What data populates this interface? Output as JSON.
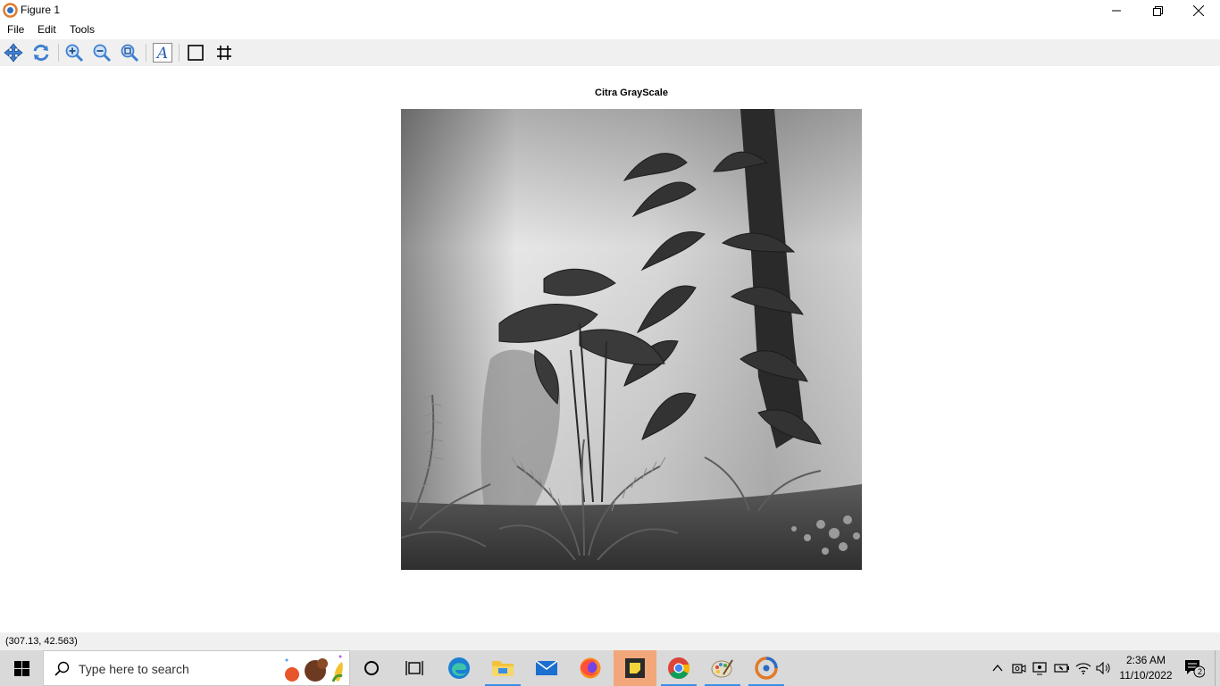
{
  "window": {
    "title": "Figure 1"
  },
  "menu": [
    "File",
    "Edit",
    "Tools"
  ],
  "toolbar": {
    "icons": [
      "pan-icon",
      "reset-view-icon",
      "zoom-in-icon",
      "zoom-out-icon",
      "zoom-fit-icon",
      "insert-text-icon",
      "axes-box-icon",
      "grid-icon"
    ]
  },
  "figure": {
    "title": "Citra GrayScale",
    "image_description": "grayscale photograph of tropical plants (monstera, palms, ferns) against a white wall"
  },
  "status": {
    "coordinates": "(307.13, 42.563)"
  },
  "taskbar": {
    "search_placeholder": "Type here to search",
    "apps": [
      "cortana-icon",
      "task-view-icon",
      "edge-icon",
      "file-explorer-icon",
      "mail-icon",
      "firefox-icon",
      "sticky-notes-icon",
      "chrome-icon",
      "paint-icon",
      "octave-icon"
    ],
    "time": "2:36 AM",
    "date": "11/10/2022",
    "notification_count": "2"
  },
  "colors": {
    "toolbar_bg": "#f0f0f0",
    "taskbar_bg": "#d9d9d9",
    "active_app_bg": "#f1a77a",
    "accent": "#3a8ee6"
  }
}
